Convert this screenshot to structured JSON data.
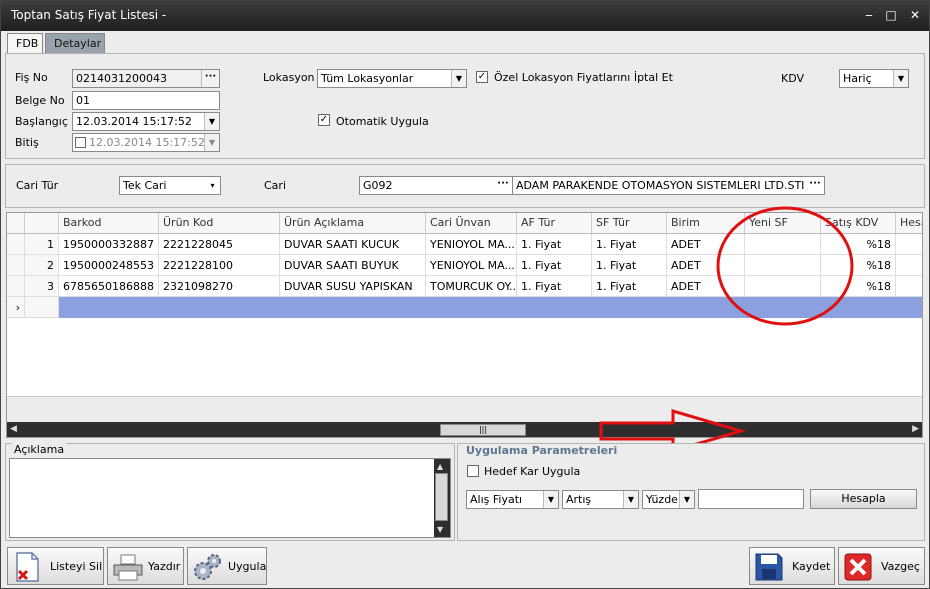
{
  "window": {
    "title": "Toptan Satış Fiyat Listesi -",
    "min_icon": "minimize-icon",
    "max_icon": "maximize-icon",
    "close_icon": "close-icon"
  },
  "tabs": [
    {
      "label": "FDB",
      "active": true
    },
    {
      "label": "Detaylar",
      "active": false
    }
  ],
  "header": {
    "fis_no_label": "Fiş No",
    "fis_no_value": "0214031200043",
    "belge_no_label": "Belge No",
    "belge_no_value": "01",
    "baslangic_label": "Başlangıç",
    "baslangic_value": "12.03.2014 15:17:52",
    "bitis_label": "Bitiş",
    "bitis_value": "12.03.2014 15:17:52",
    "lokasyon_label": "Lokasyon",
    "lokasyon_value": "Tüm Lokasyonlar",
    "ozel_lokasyon_label": "Özel Lokasyon Fiyatlarını İptal Et",
    "ozel_lokasyon_checked": true,
    "otomatik_label": "Otomatik Uygula",
    "otomatik_checked": true,
    "kdv_label": "KDV",
    "kdv_value": "Hariç"
  },
  "cari": {
    "cari_tur_label": "Cari Tür",
    "cari_tur_value": "Tek Cari",
    "cari_label": "Cari",
    "cari_code": "G092",
    "cari_name": "ADAM PARAKENDE OTOMASYON SISTEMLERI LTD.STI"
  },
  "grid": {
    "columns": [
      "Barkod",
      "Ürün Kod",
      "Ürün Açıklama",
      "Cari Ünvan",
      "AF Tür",
      "SF Tür",
      "Birim",
      "Yeni SF",
      "Satış KDV",
      "Hesa"
    ],
    "rows": [
      {
        "n": "1",
        "barkod": "1950000332887",
        "urun_kod": "2221228045",
        "aciklama": "DUVAR SAATI  KUCUK",
        "cari_unvan": "YENIOYOL MA...",
        "af_tur": "1. Fiyat",
        "sf_tur": "1. Fiyat",
        "birim": "ADET",
        "yeni_sf": "",
        "satis_kdv": "%18"
      },
      {
        "n": "2",
        "barkod": "1950000248553",
        "urun_kod": "2221228100",
        "aciklama": "DUVAR SAATI BUYUK",
        "cari_unvan": "YENIOYOL MA...",
        "af_tur": "1. Fiyat",
        "sf_tur": "1. Fiyat",
        "birim": "ADET",
        "yeni_sf": "",
        "satis_kdv": "%18"
      },
      {
        "n": "3",
        "barkod": "6785650186888",
        "urun_kod": "2321098270",
        "aciklama": "DUVAR SUSU YAPISKAN",
        "cari_unvan": "TOMURCUK OY...",
        "af_tur": "1. Fiyat",
        "sf_tur": "1. Fiyat",
        "birim": "ADET",
        "yeni_sf": "",
        "satis_kdv": "%18"
      }
    ],
    "new_row_marker": "›"
  },
  "aciklama": {
    "label": "Açıklama",
    "value": ""
  },
  "params": {
    "title": "Uygulama Parametreleri",
    "hedef_kar_label": "Hedef Kar Uygula",
    "hedef_kar_checked": false,
    "fiyat_select": "Alış Fiyatı",
    "artis_select": "Artış",
    "yuzde_select": "Yüzde",
    "amount_value": "",
    "hesapla_label": "Hesapla"
  },
  "buttons": {
    "listeyi_sil": "Listeyi Sil",
    "yazdir": "Yazdır",
    "uygula": "Uygula",
    "kaydet": "Kaydet",
    "vazgec": "Vazgeç"
  },
  "colors": {
    "selected_row": "#8c9fde",
    "annotation": "#e01010",
    "titlebar": "#2b2b2b"
  }
}
